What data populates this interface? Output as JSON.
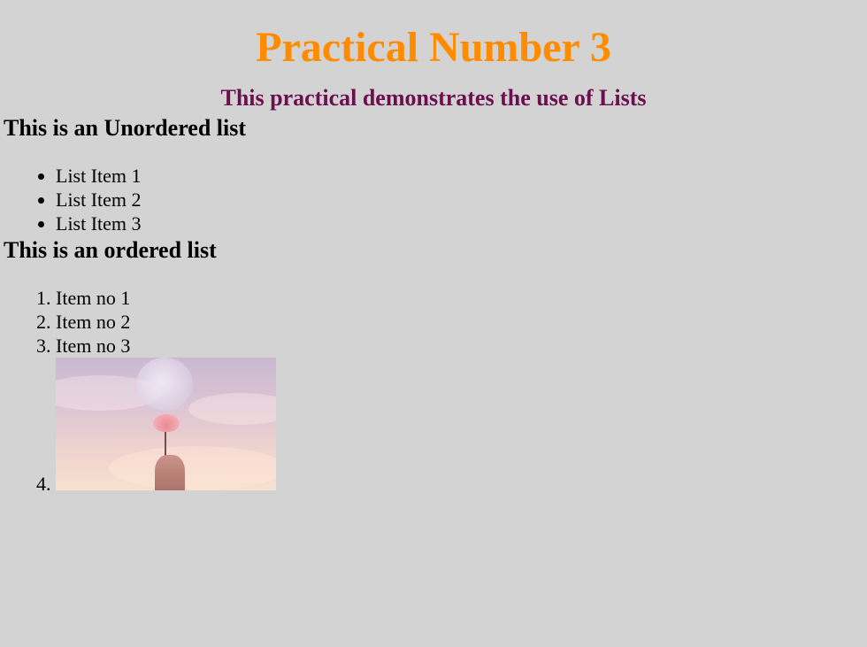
{
  "page": {
    "title": "Practical Number 3",
    "subtitle": "This practical demonstrates the use of Lists",
    "colors": {
      "background": "#d3d3d3",
      "title": "#ff8c00",
      "subtitle": "#6b0f4e"
    }
  },
  "unordered_section": {
    "heading": "This is an Unordered list",
    "items": [
      "List Item 1",
      "List Item 2",
      "List Item 3"
    ]
  },
  "ordered_section": {
    "heading": "This is an ordered list",
    "items": [
      "Item no 1",
      "Item no 2",
      "Item no 3"
    ]
  }
}
